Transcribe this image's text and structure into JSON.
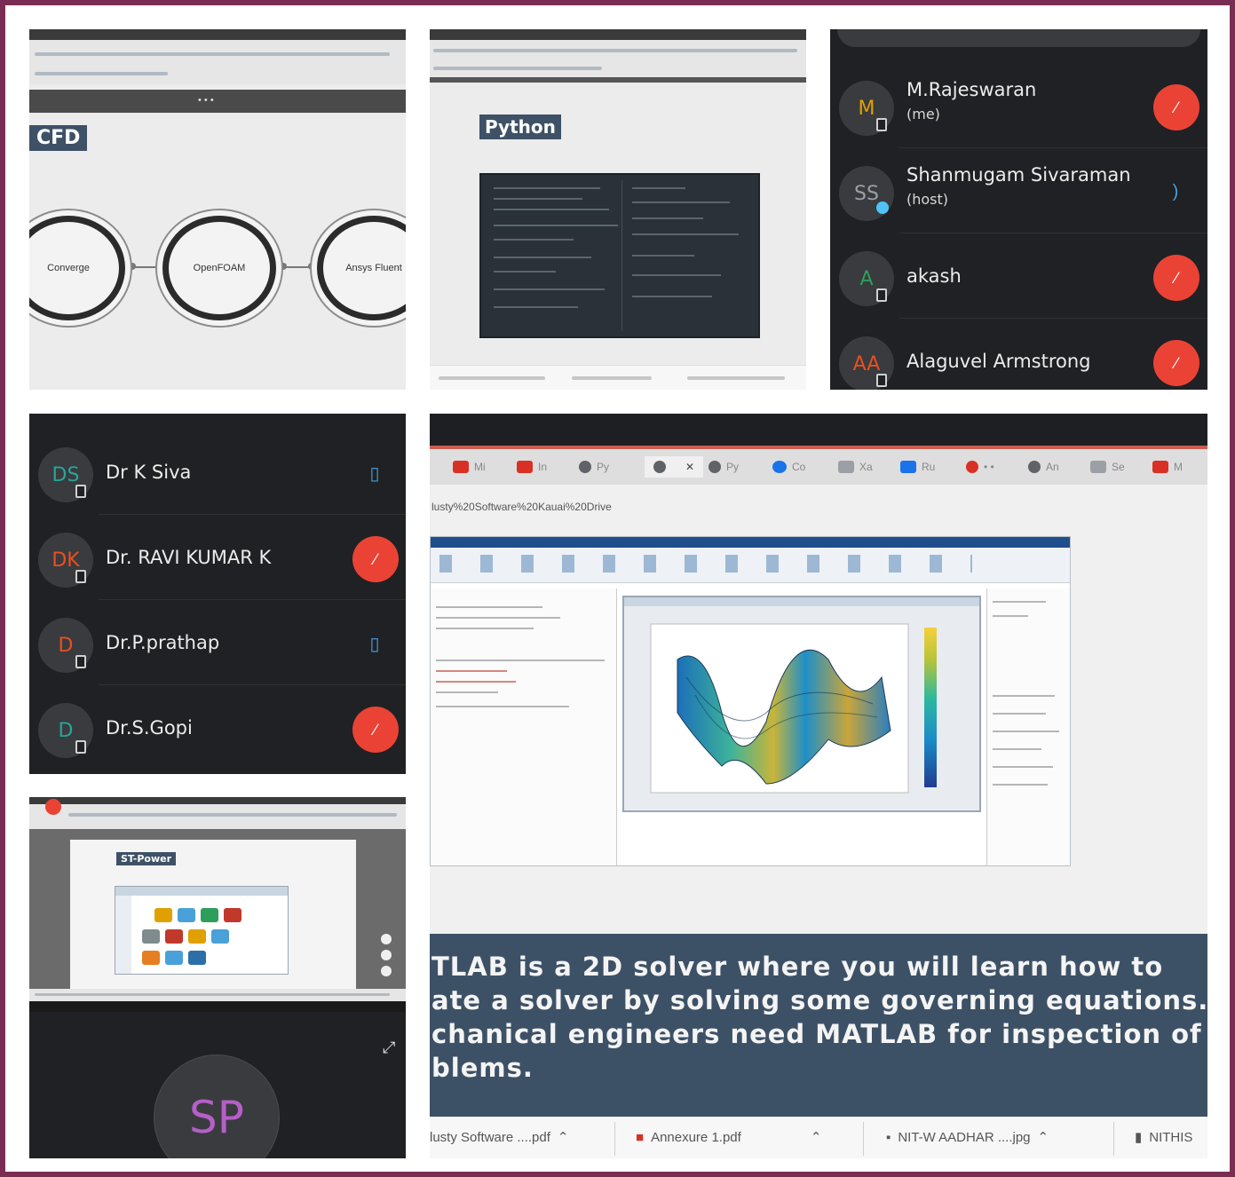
{
  "cfd_tile": {
    "label": "CFD",
    "nodes": [
      "Converge",
      "OpenFOAM",
      "Ansys Fluent"
    ]
  },
  "python_tile": {
    "label": "Python"
  },
  "participants_top": [
    {
      "initials": "M",
      "name": "M.Rajeswaran",
      "subtitle": "(me)",
      "color": "#e0a100",
      "muted": true
    },
    {
      "initials": "SS",
      "name": "Shanmugam Sivaraman",
      "subtitle": "(host)",
      "color": "#9aa0a6",
      "muted": false
    },
    {
      "initials": "A",
      "name": "akash",
      "subtitle": "",
      "color": "#2e9e5c",
      "muted": true
    },
    {
      "initials": "AA",
      "name": "Alaguvel Armstrong",
      "subtitle": "",
      "color": "#e8501f",
      "muted": true
    }
  ],
  "participants_bottom": [
    {
      "initials": "DS",
      "name": "Dr K Siva",
      "color": "#26a69a",
      "muted": false
    },
    {
      "initials": "DK",
      "name": "Dr. RAVI KUMAR K",
      "color": "#e8501f",
      "muted": true
    },
    {
      "initials": "D",
      "name": "Dr.P.prathap",
      "color": "#e8501f",
      "muted": false
    },
    {
      "initials": "D",
      "name": "Dr.S.Gopi",
      "color": "#26a69a",
      "muted": true
    }
  ],
  "stpower_tile": {
    "label": "ST-Power",
    "presenter_initials": "SP"
  },
  "matlab_tile": {
    "url_fragment": "lusty%20Software%20Kauai%20Drive",
    "caption_lines": [
      "TLAB is a 2D solver where you will learn how to",
      "ate a solver by solving some governing equations.",
      "chanical engineers need MATLAB for inspection of",
      "blems."
    ],
    "downloads": [
      {
        "name": "lusty Software ....pdf"
      },
      {
        "name": "Annexure 1.pdf"
      },
      {
        "name": "NIT-W AADHAR ....jpg"
      },
      {
        "name": "NITHIS"
      }
    ]
  },
  "icons": {
    "muted": "mic-off-icon",
    "unmuted": "mic-on-icon",
    "device": "device-badge-icon"
  },
  "colors": {
    "meet_dark": "#202124",
    "mute_red": "#ea4335",
    "slide_blue": "#3d5166",
    "frame_purple": "#7a2d52"
  }
}
